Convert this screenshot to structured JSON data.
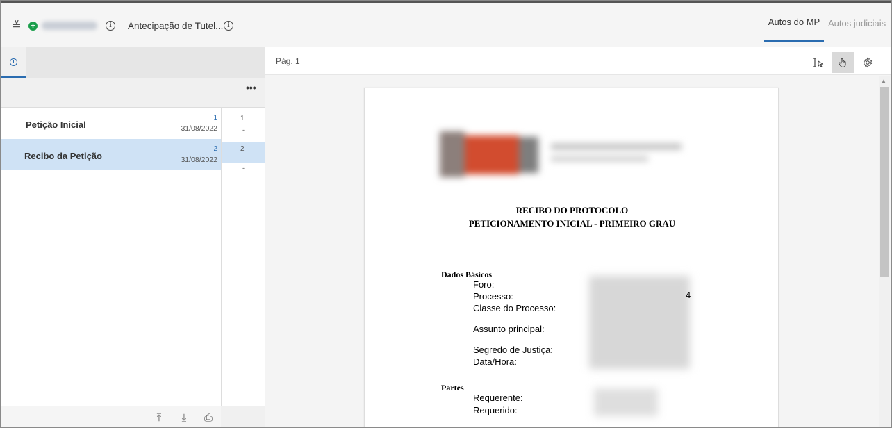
{
  "header": {
    "title": "Antecipação de Tutel...",
    "tabs": [
      {
        "label": "Autos do MP",
        "active": true
      },
      {
        "label": "Autos judiciais",
        "active": false
      }
    ]
  },
  "left_panel": {
    "documents": [
      {
        "title": "Petição Inicial",
        "num": "1",
        "date": "31/08/2022",
        "selected": false
      },
      {
        "title": "Recibo da Petição",
        "num": "2",
        "date": "31/08/2022",
        "selected": true
      }
    ],
    "pages": [
      {
        "num": "1",
        "dash": "-"
      },
      {
        "num": "2",
        "dash": "-"
      }
    ],
    "more_label": "•••"
  },
  "viewer": {
    "page_label": "Pág. 1"
  },
  "document": {
    "title_line1": "RECIBO DO PROTOCOLO",
    "title_line2": "PETICIONAMENTO INICIAL - PRIMEIRO GRAU",
    "section_basic": "Dados Básicos",
    "fields": [
      "Foro:",
      "Processo:",
      "Classe do Processo:",
      "Assunto principal:",
      "Segredo de Justiça:",
      "Data/Hora:"
    ],
    "process_fragment": "4",
    "section_parties": "Partes",
    "parties": [
      "Requerente:",
      "Requerido:"
    ]
  },
  "colors": {
    "accent": "#2a6cb0",
    "selection": "#cfe2f5",
    "add_green": "#1a9e4b"
  }
}
